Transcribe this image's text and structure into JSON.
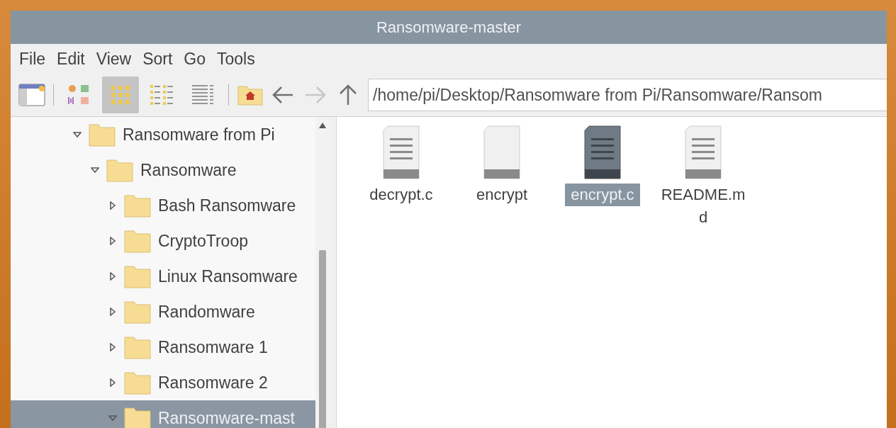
{
  "window": {
    "title": "Ransomware-master"
  },
  "menu": [
    "File",
    "Edit",
    "View",
    "Sort",
    "Go",
    "Tools"
  ],
  "view_modes": [
    {
      "kind": "thumbnail",
      "selected": false
    },
    {
      "kind": "icon",
      "selected": true
    },
    {
      "kind": "compact",
      "selected": false
    },
    {
      "kind": "list",
      "selected": false
    }
  ],
  "navigation": [
    {
      "kind": "back",
      "disabled": false
    },
    {
      "kind": "forward",
      "disabled": true
    },
    {
      "kind": "up",
      "disabled": false
    }
  ],
  "path": {
    "value": "/home/pi/Desktop/Ransomware from Pi/Ransomware/Ransom"
  },
  "tree": [
    {
      "label": "Ransomware from Pi",
      "expanded": true,
      "selected": false,
      "children": [
        {
          "label": "Ransomware",
          "expanded": true,
          "selected": false,
          "children": [
            {
              "label": "Bash Ransomware",
              "expanded": false,
              "selected": false
            },
            {
              "label": "CryptoTroop",
              "expanded": false,
              "selected": false
            },
            {
              "label": "Linux Ransomware",
              "expanded": false,
              "selected": false
            },
            {
              "label": "Randomware",
              "expanded": false,
              "selected": false
            },
            {
              "label": "Ransomware 1",
              "expanded": false,
              "selected": false
            },
            {
              "label": "Ransomware 2",
              "expanded": false,
              "selected": false
            },
            {
              "label": "Ransomware-mast",
              "expanded": true,
              "selected": true
            }
          ]
        }
      ]
    }
  ],
  "files": [
    {
      "name": "decrypt.c",
      "kind": "text",
      "selected": false
    },
    {
      "name": "encrypt",
      "kind": "blank",
      "selected": false
    },
    {
      "name": "encrypt.c",
      "kind": "text",
      "selected": true
    },
    {
      "name": "README.md",
      "kind": "text",
      "selected": false
    }
  ]
}
